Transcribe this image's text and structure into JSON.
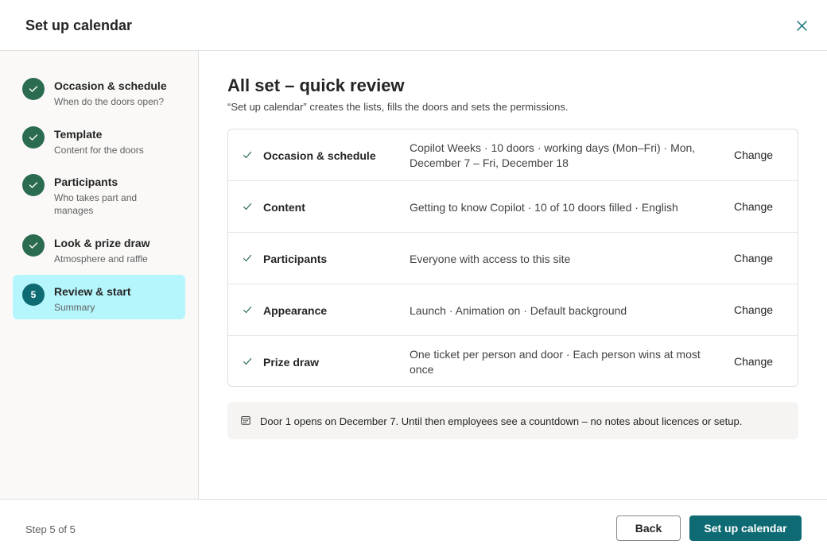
{
  "dialog": {
    "title": "Set up calendar",
    "close_icon": "close-icon"
  },
  "steps": [
    {
      "label": "Occasion & schedule",
      "sub": "When do the doors open?",
      "status": "done",
      "icon": "checkmark-icon"
    },
    {
      "label": "Template",
      "sub": "Content for the doors",
      "status": "done",
      "icon": "checkmark-icon"
    },
    {
      "label": "Participants",
      "sub": "Who takes part and manages",
      "status": "done",
      "icon": "checkmark-icon"
    },
    {
      "label": "Look & prize draw",
      "sub": "Atmosphere and raffle",
      "status": "done",
      "icon": "checkmark-icon"
    },
    {
      "number": "5",
      "label": "Review & start",
      "sub": "Summary",
      "status": "active"
    }
  ],
  "main": {
    "title": "All set – quick review",
    "description": "“Set up calendar” creates the lists, fills the doors and sets the permissions."
  },
  "review_rows": [
    {
      "label": "Occasion & schedule",
      "value": "Copilot Weeks · 10 doors · working days (Mon–Fri) · Mon, December 7 – Fri, December 18",
      "action": "Change"
    },
    {
      "label": "Content",
      "value": "Getting to know Copilot · 10 of 10 doors filled · English",
      "action": "Change"
    },
    {
      "label": "Participants",
      "value": "Everyone with access to this site",
      "action": "Change"
    },
    {
      "label": "Appearance",
      "value": "Launch · Animation on · Default background",
      "action": "Change"
    },
    {
      "label": "Prize draw",
      "value": "One ticket per person and door · Each person wins at most once",
      "action": "Change"
    }
  ],
  "note": {
    "icon": "calendar-icon",
    "text": "Door 1 opens on December 7. Until then employees see a countdown – no notes about licences or setup."
  },
  "footer": {
    "step_info": "Step 5 of 5",
    "back_label": "Back",
    "primary_label": "Set up calendar"
  },
  "colors": {
    "accent": "#0e6a73",
    "done_badge": "#2b6b4f",
    "active_step_bg": "#b5f6fc",
    "sidebar_bg": "#faf9f8",
    "note_bg": "#f5f4f2"
  }
}
